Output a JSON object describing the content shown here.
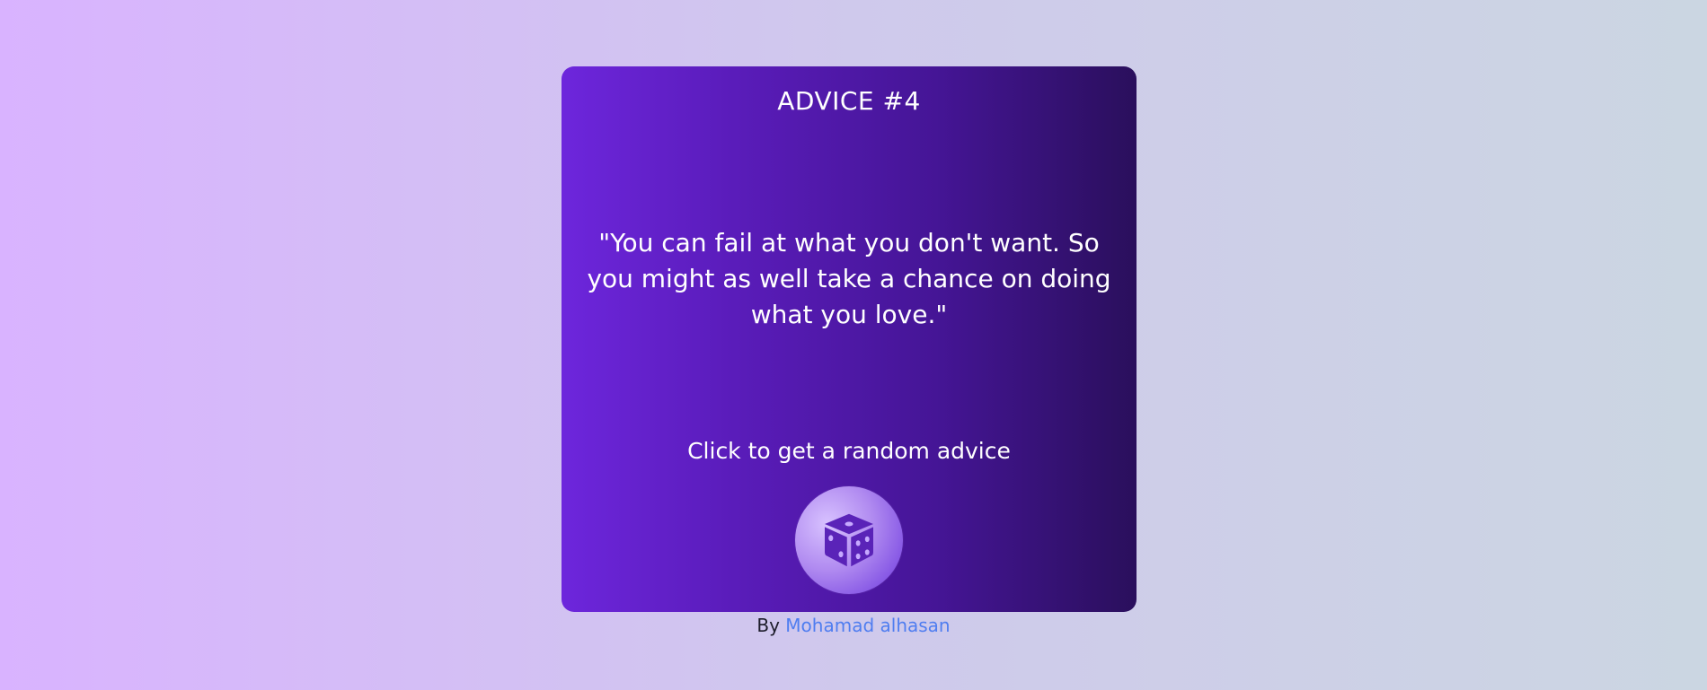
{
  "card": {
    "title": "ADVICE #4",
    "quote": "\"You can fail at what you don't want. So you might as well take a chance on doing what you love.\"",
    "cta": "Click to get a random advice",
    "dice_button_icon": "dice-icon"
  },
  "footer": {
    "by_label": "By",
    "author_link": "Mohamad alhasan"
  },
  "colors": {
    "card_start": "#6d26dc",
    "card_end": "#2a0f5c",
    "link": "#4f7df0",
    "bg_left": "#d9b3ff",
    "bg_right": "#cbd6e2"
  }
}
